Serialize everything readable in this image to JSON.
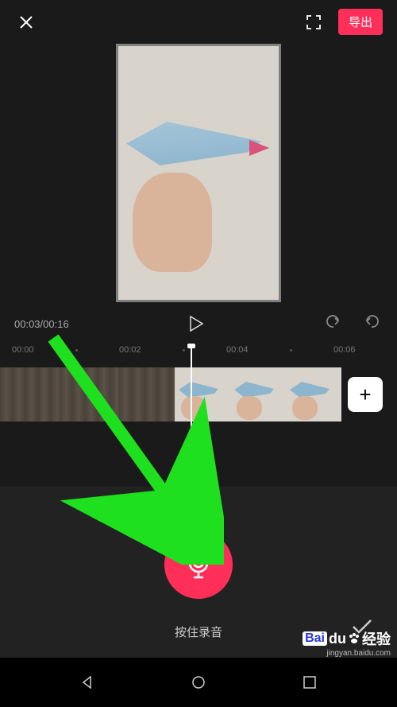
{
  "topbar": {
    "export_label": "导出"
  },
  "playback": {
    "current_time": "00:03",
    "total_time": "00:16",
    "display": "00:03/00:16"
  },
  "timeline": {
    "labels": [
      "00:00",
      "00:02",
      "00:04",
      "00:06"
    ]
  },
  "record": {
    "label": "按住录音"
  },
  "watermark": {
    "brand_prefix": "Bai",
    "brand_suffix": "经验",
    "url": "jingyan.baidu.com"
  }
}
